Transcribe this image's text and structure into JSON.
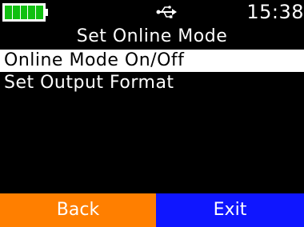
{
  "status": {
    "battery_icon": "battery-full-icon",
    "usb_icon": "usb-icon",
    "time": "15:38"
  },
  "title": "Set Online Mode",
  "menu": {
    "items": [
      {
        "label": "Online Mode On/Off",
        "selected": true
      },
      {
        "label": "Set Output Format",
        "selected": false
      }
    ]
  },
  "softkeys": {
    "back": "Back",
    "exit": "Exit"
  },
  "colors": {
    "battery": "#10c010",
    "back_key": "#ff7f00",
    "exit_key": "#0f16ff",
    "selection": "#ffffff",
    "background": "#000000"
  }
}
